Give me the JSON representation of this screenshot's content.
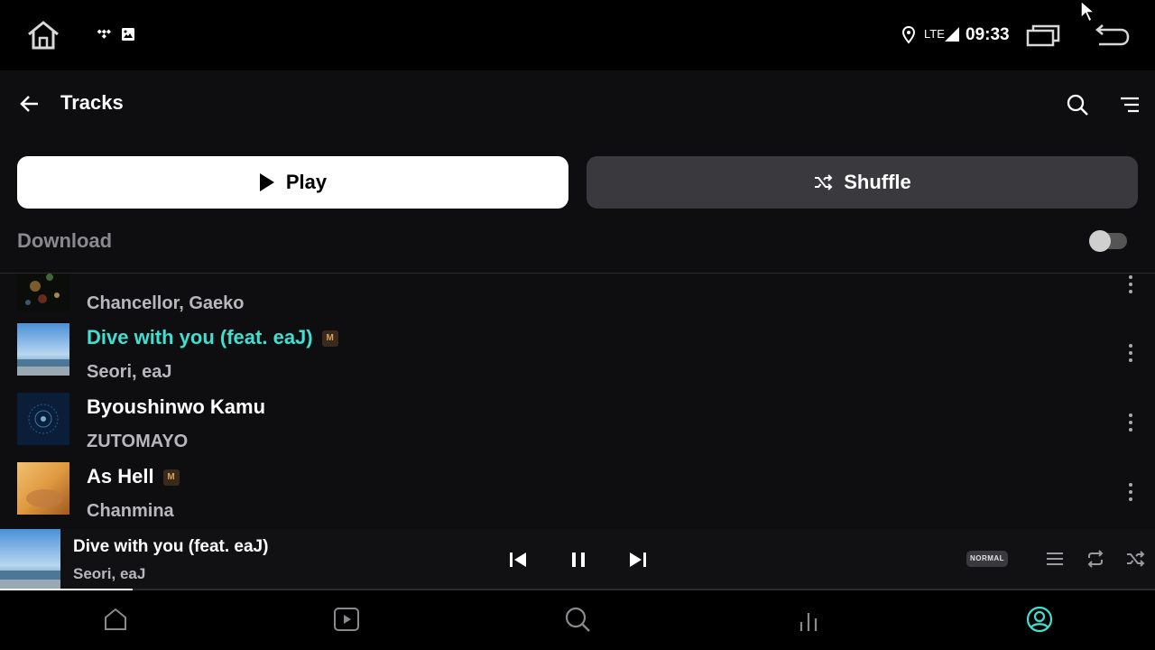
{
  "statusbar": {
    "network": "LTE",
    "time": "09:33",
    "icons": [
      "home-icon",
      "tidal-notification-icon",
      "image-notification-icon",
      "location-icon",
      "signal-icon",
      "recents-icon",
      "back-icon"
    ]
  },
  "header": {
    "title": "Tracks",
    "icons": [
      "back-arrow-icon",
      "search-icon",
      "filter-icon"
    ]
  },
  "actions": {
    "play_label": "Play",
    "shuffle_label": "Shuffle"
  },
  "download": {
    "label": "Download",
    "enabled": false
  },
  "tracks": [
    {
      "title": "",
      "artist": "Chancellor, Gaeko",
      "badge": "",
      "active": false
    },
    {
      "title": "Dive with you (feat. eaJ)",
      "artist": "Seori, eaJ",
      "badge": "M",
      "active": true
    },
    {
      "title": "Byoushinwo Kamu",
      "artist": "ZUTOMAYO",
      "badge": "",
      "active": false
    },
    {
      "title": "As Hell",
      "artist": "Chanmina",
      "badge": "M",
      "active": false
    }
  ],
  "player": {
    "title": "Dive with you (feat. eaJ)",
    "artist": "Seori, eaJ",
    "quality": "NORMAL",
    "progress": 0.115
  },
  "nav": {
    "items": [
      "home-icon",
      "video-icon",
      "search-icon",
      "stats-icon",
      "profile-icon"
    ],
    "active": "profile-icon"
  },
  "colors": {
    "accent": "#3fe0d0",
    "background": "#0e0e10",
    "shuffle_button": "#3a3a3e"
  }
}
